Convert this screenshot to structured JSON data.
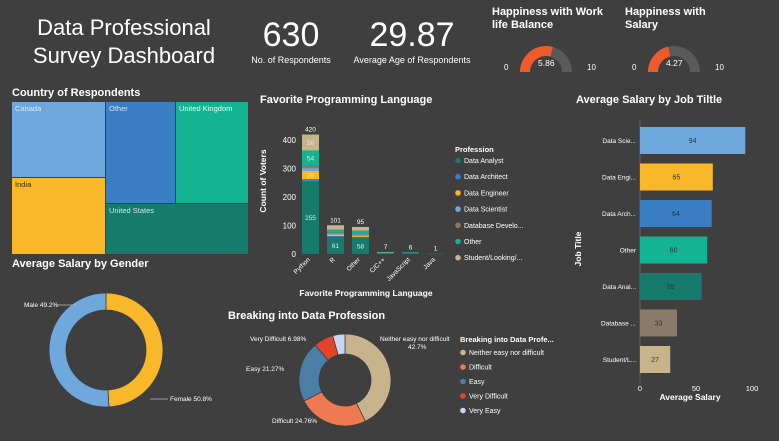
{
  "header": {
    "title_line1": "Data Professional",
    "title_line2": "Survey Dashboard",
    "kpi1_value": "630",
    "kpi1_label": "No. of Respondents",
    "kpi2_value": "29.87",
    "kpi2_label": "Average Age of Respondents"
  },
  "gauges": [
    {
      "title_line1": "Happiness with Work",
      "title_line2": "life Balance",
      "value": 5.86,
      "value_label": "5.86",
      "min": "0",
      "max": "10",
      "min_num": 0,
      "max_num": 10
    },
    {
      "title_line1": "Happiness with",
      "title_line2": "Salary",
      "value": 4.27,
      "value_label": "4.27",
      "min": "0",
      "max": "10",
      "min_num": 0,
      "max_num": 10
    }
  ],
  "treemap": {
    "title": "Country of Respondents",
    "cells": [
      {
        "label": "Canada",
        "color": "#6fa8dc"
      },
      {
        "label": "Other",
        "color": "#3a7ec4"
      },
      {
        "label": "United Kingdom",
        "color": "#14b393"
      },
      {
        "label": "India",
        "color": "#f9b82a"
      },
      {
        "label": "United States",
        "color": "#167a6c"
      }
    ]
  },
  "chart_data": [
    {
      "type": "bar",
      "title": "Favorite Programming Language",
      "xlabel": "Favorite Programming Language",
      "ylabel": "Count of Voters",
      "ylim": [
        0,
        450
      ],
      "yticks": [
        "0",
        "100",
        "200",
        "300",
        "400"
      ],
      "yticks_num": [
        0,
        100,
        200,
        300,
        400
      ],
      "categories": [
        "Python",
        "R",
        "Other",
        "C/C++",
        "JavaScript",
        "Java"
      ],
      "totals": [
        "420",
        "101",
        "95",
        "7",
        "6",
        "1"
      ],
      "totals_num": [
        420,
        101,
        95,
        7,
        6,
        1
      ],
      "legend_title": "Profession",
      "series": [
        {
          "name": "Data Analyst",
          "color": "#167a6c",
          "values": [
            255,
            61,
            58,
            4,
            4,
            1
          ],
          "labels": [
            "255",
            "61",
            "58",
            "",
            "",
            ""
          ]
        },
        {
          "name": "Data Architect",
          "color": "#3a7ec4",
          "values": [
            8,
            2,
            2,
            0,
            0,
            0
          ],
          "labels": [
            "",
            "",
            "",
            "",
            "",
            ""
          ]
        },
        {
          "name": "Data Engineer",
          "color": "#f9b82a",
          "values": [
            29,
            5,
            4,
            1,
            0,
            0
          ],
          "labels": [
            "29",
            "",
            "",
            "",
            "",
            ""
          ]
        },
        {
          "name": "Data Scientist",
          "color": "#6fa8dc",
          "values": [
            10,
            5,
            5,
            1,
            1,
            0
          ],
          "labels": [
            "",
            "",
            "",
            "",
            "",
            ""
          ]
        },
        {
          "name": "Database Develo...",
          "color": "#8a7a6a",
          "values": [
            8,
            3,
            3,
            0,
            0,
            0
          ],
          "labels": [
            "",
            "",
            "",
            "",
            "",
            ""
          ]
        },
        {
          "name": "Other",
          "color": "#14b393",
          "values": [
            54,
            10,
            10,
            1,
            1,
            0
          ],
          "labels": [
            "54",
            "",
            "",
            "",
            "",
            ""
          ]
        },
        {
          "name": "Student/Looking/...",
          "color": "#c8b48a",
          "values": [
            56,
            15,
            13,
            0,
            0,
            0
          ],
          "labels": [
            "56",
            "",
            "",
            "",
            "",
            ""
          ]
        }
      ]
    },
    {
      "type": "bar",
      "orientation": "horizontal",
      "title": "Average Salary by Job Tiltle",
      "xlabel": "Average Salary",
      "ylabel": "Job Title",
      "xlim": [
        0,
        100
      ],
      "xticks": [
        "0",
        "50",
        "100"
      ],
      "xticks_num": [
        0,
        50,
        100
      ],
      "categories": [
        "Data Scie...",
        "Data Engi...",
        "Data Arch...",
        "Other",
        "Data Anal...",
        "Database ...",
        "Student/L..."
      ],
      "values": [
        94,
        65,
        64,
        60,
        55,
        33,
        27
      ],
      "value_labels": [
        "94",
        "65",
        "64",
        "60",
        "55",
        "33",
        "27"
      ],
      "colors": [
        "#6fa8dc",
        "#f9b82a",
        "#3a7ec4",
        "#14b393",
        "#167a6c",
        "#8a7a6a",
        "#c8b48a"
      ]
    },
    {
      "type": "pie",
      "title": "Average Salary by Gender",
      "categories": [
        "Male",
        "Female"
      ],
      "values": [
        49.2,
        50.8
      ],
      "labels": [
        "Male 49.2%",
        "Female 50.8%"
      ],
      "colors": [
        "#f9b82a",
        "#6fa8dc"
      ]
    },
    {
      "type": "pie",
      "title": "Breaking into Data Profession",
      "legend_title": "Breaking into Data Profe...",
      "categories": [
        "Neither easy nor difficult",
        "Difficult",
        "Easy",
        "Very Difficult",
        "Very Easy"
      ],
      "values": [
        42.7,
        24.76,
        21.27,
        6.98,
        4.29
      ],
      "labels": [
        "Neither easy nor difficult 42.7%",
        "Difficult 24.76%",
        "Easy 21.27%",
        "Very Difficult 6.98%",
        ""
      ],
      "label_line1": "Neither easy nor difficult",
      "label_line2": "42.7%",
      "colors": [
        "#c8b48a",
        "#ef7a52",
        "#4c7fa8",
        "#e2452a",
        "#c9d5ee"
      ]
    }
  ]
}
